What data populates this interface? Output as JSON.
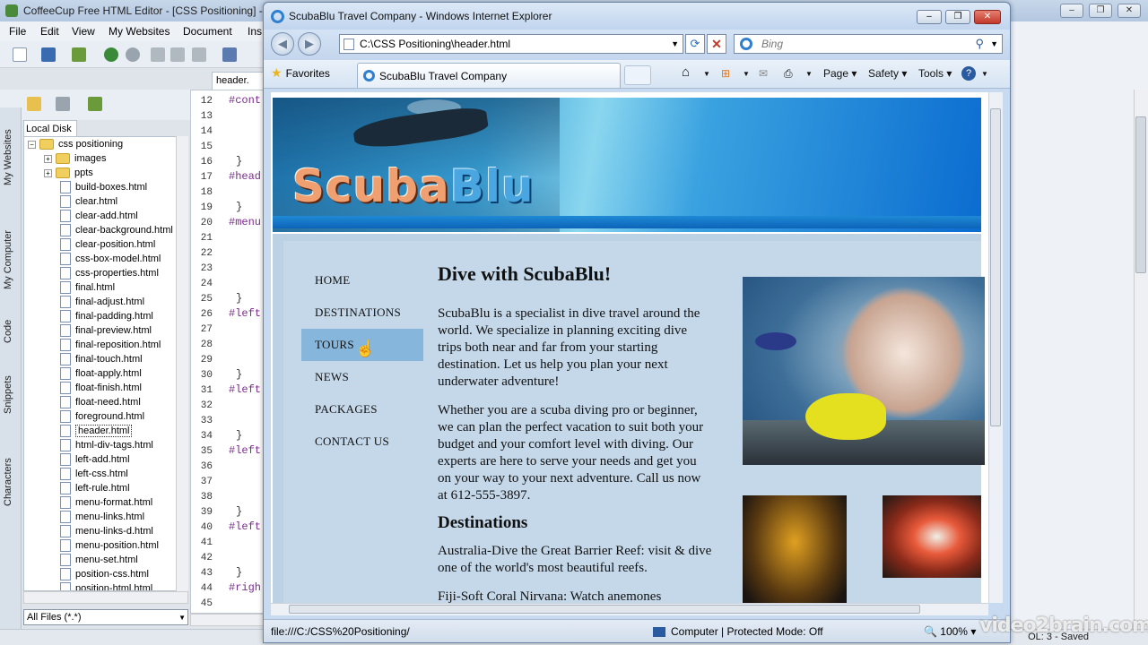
{
  "editor": {
    "title": "CoffeeCup Free HTML Editor - [CSS Positioning] -",
    "menu": [
      "File",
      "Edit",
      "View",
      "My Websites",
      "Document",
      "Ins"
    ],
    "vertical_tabs": [
      "My Websites",
      "My Computer",
      "Code",
      "Snippets",
      "Characters"
    ],
    "local_tab": "Local Disk",
    "tree": {
      "root": "css positioning",
      "folders": [
        "images",
        "ppts"
      ],
      "files": [
        "build-boxes.html",
        "clear.html",
        "clear-add.html",
        "clear-background.html",
        "clear-position.html",
        "css-box-model.html",
        "css-properties.html",
        "final.html",
        "final-adjust.html",
        "final-padding.html",
        "final-preview.html",
        "final-reposition.html",
        "final-touch.html",
        "float-apply.html",
        "float-finish.html",
        "float-need.html",
        "foreground.html",
        "header.html",
        "html-div-tags.html",
        "left-add.html",
        "left-css.html",
        "left-rule.html",
        "menu-format.html",
        "menu-links.html",
        "menu-links-d.html",
        "menu-position.html",
        "menu-set.html",
        "position-css.html",
        "position-html.html"
      ],
      "selected": "header.html"
    },
    "file_filter": "All Files (*.*)",
    "code_tab": "header.",
    "line_numbers": [
      "12",
      "13",
      "14",
      "15",
      "16",
      "17",
      "18",
      "19",
      "20",
      "21",
      "22",
      "23",
      "24",
      "25",
      "26",
      "27",
      "28",
      "29",
      "30",
      "31",
      "32",
      "33",
      "34",
      "35",
      "36",
      "37",
      "38",
      "39",
      "40",
      "41",
      "42",
      "43",
      "44",
      "45"
    ],
    "code_lines": [
      {
        "line": "12",
        "text": "#cont"
      },
      {
        "line": "16",
        "text": "}"
      },
      {
        "line": "17",
        "text": "#head"
      },
      {
        "line": "19",
        "text": "}"
      },
      {
        "line": "20",
        "text": "#menu"
      },
      {
        "line": "25",
        "text": "}"
      },
      {
        "line": "26",
        "text": "#left"
      },
      {
        "line": "30",
        "text": "}"
      },
      {
        "line": "31",
        "text": "#left"
      },
      {
        "line": "34",
        "text": "}"
      },
      {
        "line": "35",
        "text": "#left"
      },
      {
        "line": "39",
        "text": "}"
      },
      {
        "line": "40",
        "text": "#left"
      },
      {
        "line": "43",
        "text": "}"
      },
      {
        "line": "44",
        "text": "#righ"
      }
    ],
    "status": "OL: 3 - Saved",
    "watermark": "video2brain.com"
  },
  "browser": {
    "title": "ScubaBlu Travel Company - Windows Internet Explorer",
    "address": "C:\\CSS Positioning\\header.html",
    "search_placeholder": "Bing",
    "favorites_label": "Favorites",
    "tab_title": "ScubaBlu Travel Company",
    "commands": [
      "Page",
      "Safety",
      "Tools"
    ],
    "status_url": "file:///C:/CSS%20Positioning/",
    "status_zone": "Computer | Protected Mode: Off",
    "zoom": "100%"
  },
  "page": {
    "logo_part1": "Scuba",
    "logo_part2": "Blu",
    "nav": [
      "HOME",
      "DESTINATIONS",
      "TOURS",
      "NEWS",
      "PACKAGES",
      "CONTACT US"
    ],
    "active_nav": "TOURS",
    "heading": "Dive with ScubaBlu!",
    "para1": "ScubaBlu is a specialist in dive travel around the world. We specialize in planning exciting dive trips both near and far from your starting destination. Let us help you plan your next underwater adventure!",
    "para2": "Whether you are a scuba diving pro or beginner, we can plan the perfect vacation to suit both your budget and your comfort level with diving. Our experts are here to serve your needs and get you on your way to your next adventure. Call us now at 612-555-3897.",
    "heading2": "Destinations",
    "para3": "Australia-Dive the Great Barrier Reef: visit & dive one of the world's most beautiful reefs.",
    "para4": "Fiji-Soft Coral Nirvana: Watch anemones"
  }
}
